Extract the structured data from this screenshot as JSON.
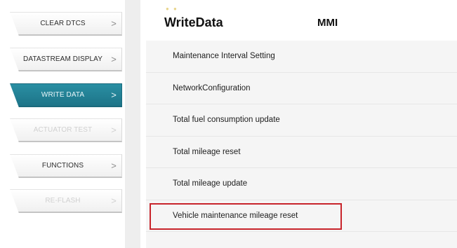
{
  "sidebar": {
    "items": [
      {
        "label": "CLEAR DTCS",
        "chevron": ">"
      },
      {
        "label": "DATASTREAM DISPLAY",
        "chevron": ">"
      },
      {
        "label": "WRITE DATA",
        "chevron": ">"
      },
      {
        "label": "ACTUATOR TEST",
        "chevron": ">"
      },
      {
        "label": "FUNCTIONS",
        "chevron": ">"
      },
      {
        "label": "RE-FLASH",
        "chevron": ">"
      }
    ]
  },
  "header": {
    "title": "WriteData",
    "subtitle": "MMI"
  },
  "list": {
    "items": [
      "Maintenance Interval Setting",
      "NetworkConfiguration",
      "Total fuel consumption update",
      "Total mileage reset",
      "Total mileage update",
      "Vehicle maintenance mileage reset"
    ]
  },
  "colors": {
    "active_item": "#1f7d91",
    "highlight_box": "#c8242b"
  }
}
